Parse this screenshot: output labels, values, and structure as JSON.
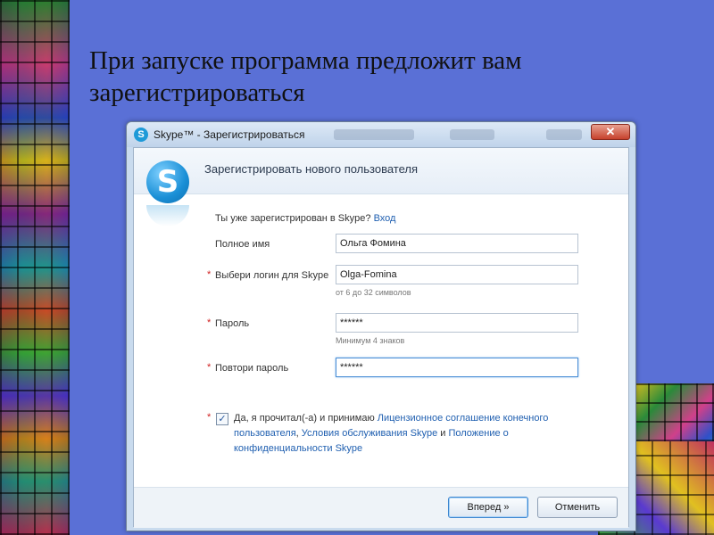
{
  "slide": {
    "title": "При запуске программа предложит вам зарегистрироваться"
  },
  "window": {
    "title": "Skype™ - Зарегистрироваться",
    "close_label": "✕",
    "logo_glyph": "S"
  },
  "form": {
    "header": "Зарегистрировать нового пользователя",
    "already_registered": "Ты уже зарегистрирован в Skype?",
    "login_link": "Вход",
    "required_mark": "*",
    "full_name_label": "Полное имя",
    "full_name_value": "Ольга Фомина",
    "login_label": "Выбери логин для Skype",
    "login_value": "Olga-Fomina",
    "login_hint": "от 6 до 32 символов",
    "password_label": "Пароль",
    "password_value": "******",
    "password_hint": "Минимум 4 знаков",
    "repeat_label": "Повтори пароль",
    "repeat_value": "******",
    "checkbox_mark": "✓",
    "agree_text": "Да, я прочитал(-а) и принимаю",
    "eula_link": "Лицензионное соглашение конечного пользователя",
    "comma": ",",
    "terms_link": "Условия обслуживания Skype",
    "and": "и",
    "privacy_link": "Положение о конфиденциальности Skype"
  },
  "buttons": {
    "next": "Вперед »",
    "cancel": "Отменить"
  }
}
